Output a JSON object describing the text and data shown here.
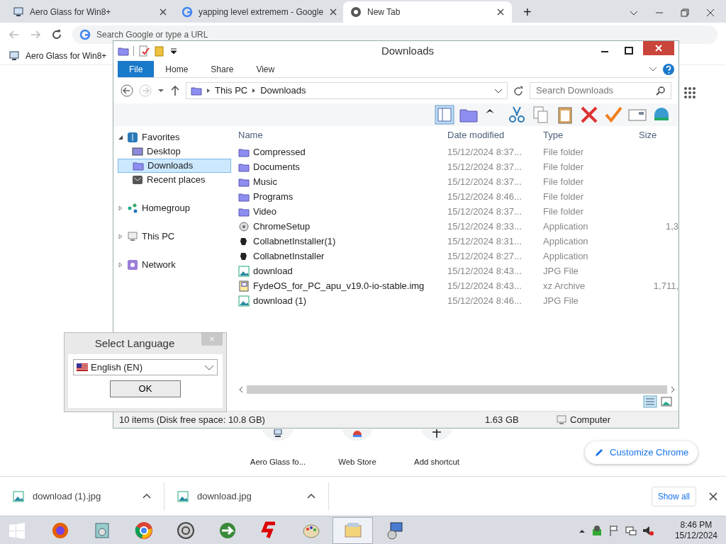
{
  "browser": {
    "tabs": [
      {
        "title": "Aero Glass for Win8+",
        "selected": false
      },
      {
        "title": "yapping level extremem - Google",
        "selected": false
      },
      {
        "title": "New Tab",
        "selected": true
      }
    ],
    "new_tab_button": "+",
    "omnibox": {
      "placeholder": "Search Google or type a URL"
    },
    "bookmarks": [
      {
        "label": "Aero Glass for Win8+"
      }
    ],
    "shortcuts": [
      {
        "label": "Aero Glass fo..."
      },
      {
        "label": "Web Store"
      },
      {
        "label": "Add shortcut"
      }
    ],
    "customize_button": "Customize Chrome",
    "downloads": [
      {
        "name": "download (1).jpg"
      },
      {
        "name": "download.jpg"
      }
    ],
    "show_all": "Show all"
  },
  "explorer": {
    "title": "Downloads",
    "ribbon_tabs": [
      {
        "label": "File",
        "selected": true
      },
      {
        "label": "Home",
        "selected": false
      },
      {
        "label": "Share",
        "selected": false
      },
      {
        "label": "View",
        "selected": false
      }
    ],
    "breadcrumb": [
      "This PC",
      "Downloads"
    ],
    "search": {
      "placeholder": "Search Downloads"
    },
    "nav": [
      {
        "label": "Favorites",
        "expanded": true,
        "selected": false,
        "children": [
          {
            "label": "Desktop",
            "selected": false
          },
          {
            "label": "Downloads",
            "selected": true
          },
          {
            "label": "Recent places",
            "selected": false
          }
        ]
      },
      {
        "label": "Homegroup",
        "expanded": false,
        "selected": false
      },
      {
        "label": "This PC",
        "expanded": false,
        "selected": false
      },
      {
        "label": "Network",
        "expanded": false,
        "selected": false
      }
    ],
    "columns": [
      "Name",
      "Date modified",
      "Type",
      "Size"
    ],
    "rows": [
      {
        "kind": "folder",
        "name": "Compressed",
        "date": "15/12/2024 8:37...",
        "type": "File folder",
        "size": ""
      },
      {
        "kind": "folder",
        "name": "Documents",
        "date": "15/12/2024 8:37...",
        "type": "File folder",
        "size": ""
      },
      {
        "kind": "folder",
        "name": "Music",
        "date": "15/12/2024 8:37...",
        "type": "File folder",
        "size": ""
      },
      {
        "kind": "folder",
        "name": "Programs",
        "date": "15/12/2024 8:46...",
        "type": "File folder",
        "size": ""
      },
      {
        "kind": "folder",
        "name": "Video",
        "date": "15/12/2024 8:37...",
        "type": "File folder",
        "size": ""
      },
      {
        "kind": "setup",
        "name": "ChromeSetup",
        "date": "15/12/2024 8:33...",
        "type": "Application",
        "size": "1,3"
      },
      {
        "kind": "app",
        "name": "CollabnetInstaller(1)",
        "date": "15/12/2024 8:31...",
        "type": "Application",
        "size": ""
      },
      {
        "kind": "app",
        "name": "CollabnetInstaller",
        "date": "15/12/2024 8:27...",
        "type": "Application",
        "size": ""
      },
      {
        "kind": "image",
        "name": "download",
        "date": "15/12/2024 8:43...",
        "type": "JPG File",
        "size": ""
      },
      {
        "kind": "archive",
        "name": "FydeOS_for_PC_apu_v19.0-io-stable.img",
        "date": "15/12/2024 8:43...",
        "type": "xz Archive",
        "size": "1,711,"
      },
      {
        "kind": "image",
        "name": "download (1)",
        "date": "15/12/2024 8:46...",
        "type": "JPG File",
        "size": ""
      }
    ],
    "status": {
      "items": "10 items (Disk free space: 10.8 GB)",
      "size": "1.63 GB",
      "location": "Computer"
    }
  },
  "language_dialog": {
    "title": "Select Language",
    "close": "×",
    "value": "English (EN)",
    "ok": "OK"
  },
  "taskbar": {
    "apps": [
      {
        "kind": "firefox",
        "selected": false
      },
      {
        "kind": "media",
        "selected": false
      },
      {
        "kind": "chrome",
        "selected": false
      },
      {
        "kind": "gear",
        "selected": false
      },
      {
        "kind": "download",
        "selected": false
      },
      {
        "kind": "s",
        "selected": false
      },
      {
        "kind": "paint",
        "selected": false
      },
      {
        "kind": "explorer",
        "selected": true
      },
      {
        "kind": "setup",
        "selected": false
      }
    ],
    "time": "8:46 PM",
    "date": "15/12/2024"
  }
}
